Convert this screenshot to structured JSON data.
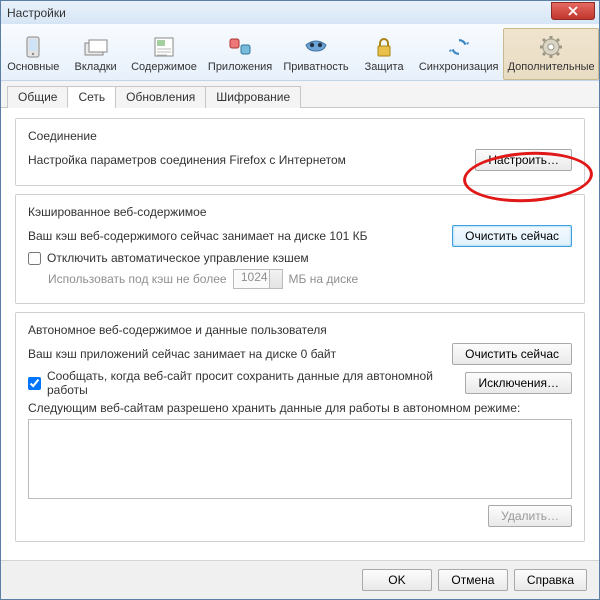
{
  "title": "Настройки",
  "toolbar": [
    {
      "label": "Основные"
    },
    {
      "label": "Вкладки"
    },
    {
      "label": "Содержимое"
    },
    {
      "label": "Приложения"
    },
    {
      "label": "Приватность"
    },
    {
      "label": "Защита"
    },
    {
      "label": "Синхронизация"
    },
    {
      "label": "Дополнительные"
    }
  ],
  "subtabs": [
    "Общие",
    "Сеть",
    "Обновления",
    "Шифрование"
  ],
  "connection": {
    "heading": "Соединение",
    "desc": "Настройка параметров соединения Firefox с Интернетом",
    "settings_btn": "Настроить…"
  },
  "cache": {
    "heading": "Кэшированное веб-содержимое",
    "status": "Ваш кэш веб-содержимого сейчас занимает на диске 101 КБ",
    "clear_btn": "Очистить сейчас",
    "override_label": "Отключить автоматическое управление кэшем",
    "limit_prefix": "Использовать под кэш не более",
    "limit_value": "1024",
    "limit_suffix": "МБ на диске"
  },
  "offline": {
    "heading": "Автономное веб-содержимое и данные пользователя",
    "status": "Ваш кэш приложений сейчас занимает на диске 0 байт",
    "clear_btn": "Очистить сейчас",
    "notify_label": "Сообщать, когда веб-сайт просит сохранить данные для автономной работы",
    "exceptions_btn": "Исключения…",
    "allowed_label": "Следующим веб-сайтам разрешено хранить данные для работы в автономном режиме:",
    "remove_btn": "Удалить…"
  },
  "footer": {
    "ok": "OK",
    "cancel": "Отмена",
    "help": "Справка"
  }
}
